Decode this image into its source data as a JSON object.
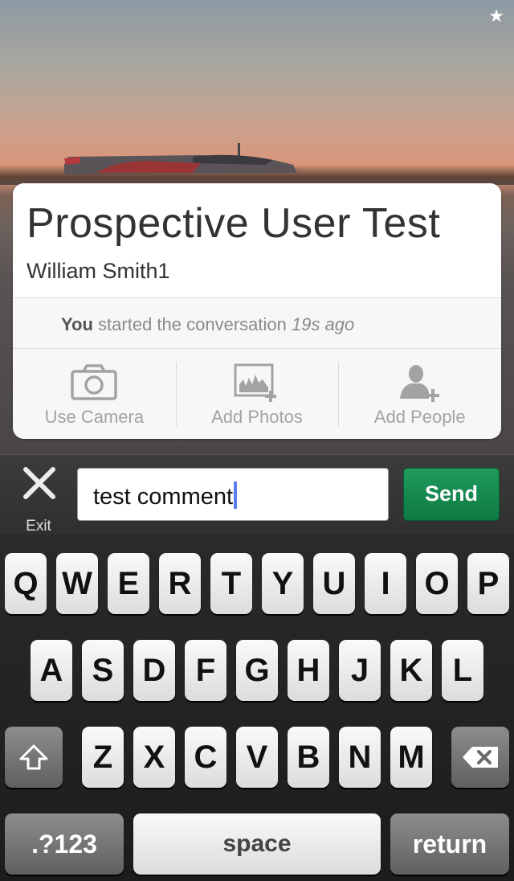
{
  "card": {
    "title": "Prospective User Test",
    "subtitle": "William Smith1",
    "activity": {
      "actor": "You",
      "text": "started the conversation",
      "time": "19s ago"
    },
    "actions": [
      {
        "label": "Use Camera",
        "icon": "camera-icon"
      },
      {
        "label": "Add Photos",
        "icon": "add-photos-icon"
      },
      {
        "label": "Add People",
        "icon": "add-people-icon"
      }
    ]
  },
  "comment_bar": {
    "exit_label": "Exit",
    "input_value": "test comment",
    "send_label": "Send"
  },
  "keyboard": {
    "row1": [
      "Q",
      "W",
      "E",
      "R",
      "T",
      "Y",
      "U",
      "I",
      "O",
      "P"
    ],
    "row2": [
      "A",
      "S",
      "D",
      "F",
      "G",
      "H",
      "J",
      "K",
      "L"
    ],
    "row3": [
      "Z",
      "X",
      "C",
      "V",
      "B",
      "N",
      "M"
    ],
    "numbers_label": ".?123",
    "space_label": "space",
    "return_label": "return"
  },
  "colors": {
    "send": "#0e7a44",
    "caret": "#5b7cf0",
    "card_bg": "#ffffff"
  }
}
